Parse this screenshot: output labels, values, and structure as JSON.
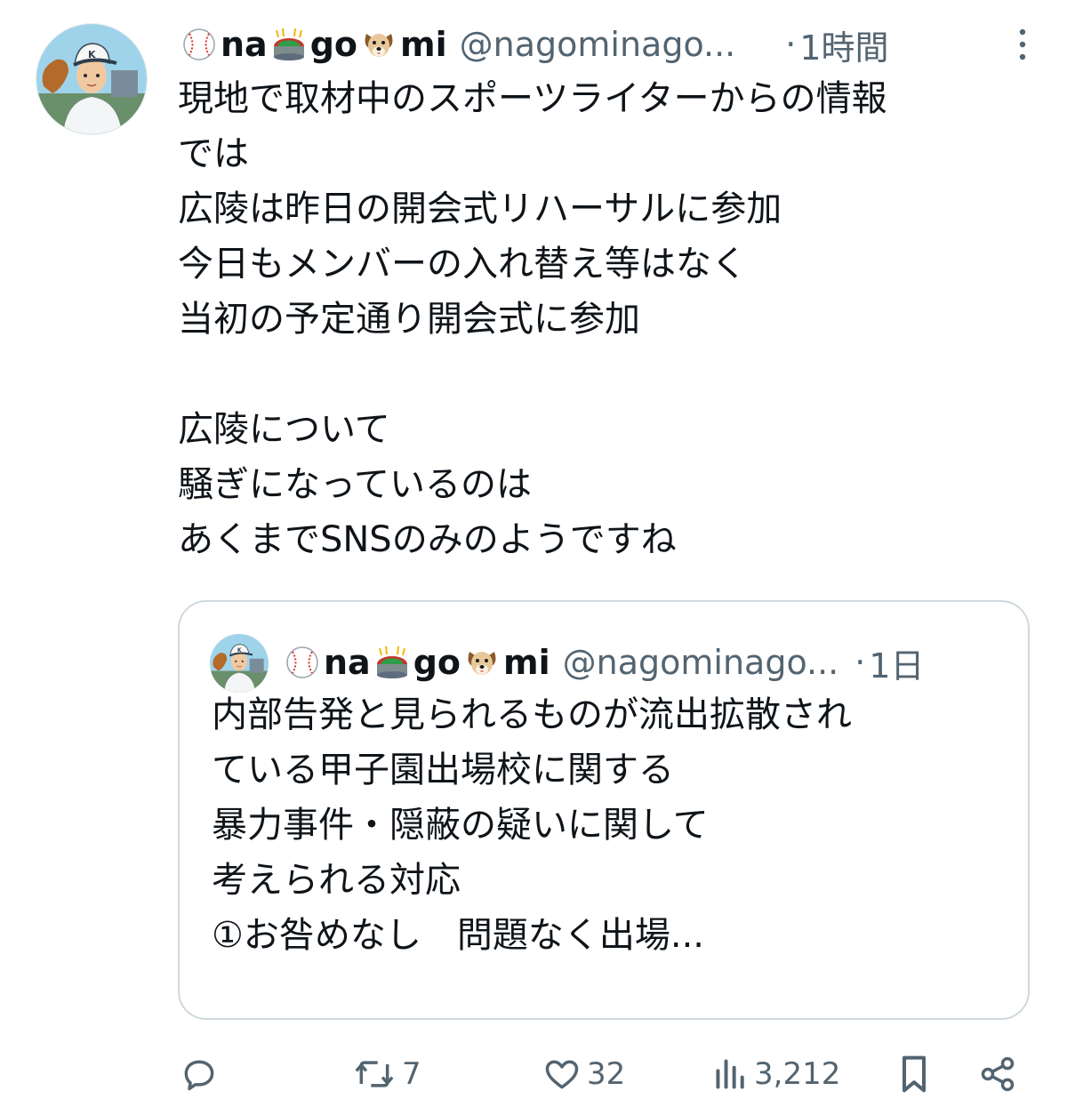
{
  "tweet": {
    "display_name_parts": [
      "na",
      "go",
      "mi"
    ],
    "handle": "@nagominago...",
    "separator": "·",
    "time": "1時間",
    "text": "現地で取材中のスポーツライターからの情報\nでは\n広陵は昨日の開会式リハーサルに参加\n今日もメンバーの入れ替え等はなく\n当初の予定通り開会式に参加\n\n広陵について\n騒ぎになっているのは\nあくまでSNSのみのようですね"
  },
  "quoted_tweet": {
    "display_name_parts": [
      "na",
      "go",
      "mi"
    ],
    "handle": "@nagominago...",
    "separator": "·",
    "time": "1日",
    "text": "内部告発と見られるものが流出拡散され\nている甲子園出場校に関する\n暴力事件・隠蔽の疑いに関して\n考えられる対応\n①お咎めなし　問題なく出場..."
  },
  "actions": {
    "reply_icon": "speech-bubble-icon",
    "retweet_icon": "retweet-icon",
    "retweet_count": "7",
    "like_icon": "heart-icon",
    "like_count": "32",
    "views_icon": "bar-chart-icon",
    "views_count": "3,212",
    "bookmark_icon": "bookmark-icon",
    "share_icon": "share-icon"
  },
  "emoji": {
    "baseball": "baseball-icon",
    "stadium": "stadium-icon",
    "dog": "dog-face-icon"
  },
  "colors": {
    "text": "#0f1419",
    "secondary": "#536471",
    "border": "#cfd9de"
  }
}
